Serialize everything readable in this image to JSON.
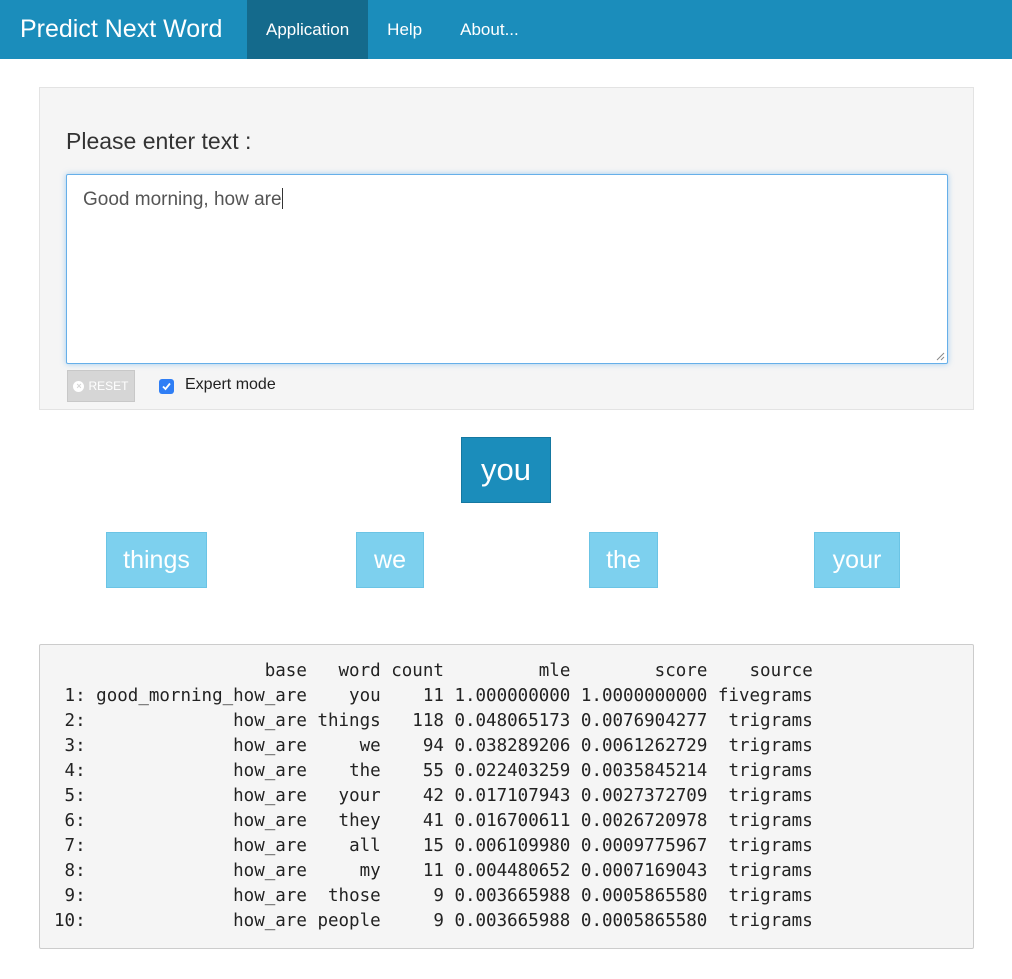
{
  "navbar": {
    "brand": "Predict Next Word",
    "tabs": [
      {
        "label": "Application",
        "active": true
      },
      {
        "label": "Help",
        "active": false
      },
      {
        "label": "About...",
        "active": false
      }
    ]
  },
  "input_panel": {
    "label": "Please enter text :",
    "text_value": "Good morning, how are",
    "reset_label": "RESET",
    "expert_mode_label": "Expert mode",
    "expert_mode_checked": true
  },
  "predictions": {
    "top": "you",
    "alternatives": [
      "things",
      "we",
      "the",
      "your"
    ]
  },
  "results_table": {
    "columns": [
      "base",
      "word",
      "count",
      "mle",
      "score",
      "source"
    ],
    "rows": [
      {
        "index": "1:",
        "base": "good_morning_how_are",
        "word": "you",
        "count": "11",
        "mle": "1.000000000",
        "score": "1.0000000000",
        "source": "fivegrams"
      },
      {
        "index": "2:",
        "base": "how_are",
        "word": "things",
        "count": "118",
        "mle": "0.048065173",
        "score": "0.0076904277",
        "source": "trigrams"
      },
      {
        "index": "3:",
        "base": "how_are",
        "word": "we",
        "count": "94",
        "mle": "0.038289206",
        "score": "0.0061262729",
        "source": "trigrams"
      },
      {
        "index": "4:",
        "base": "how_are",
        "word": "the",
        "count": "55",
        "mle": "0.022403259",
        "score": "0.0035845214",
        "source": "trigrams"
      },
      {
        "index": "5:",
        "base": "how_are",
        "word": "your",
        "count": "42",
        "mle": "0.017107943",
        "score": "0.0027372709",
        "source": "trigrams"
      },
      {
        "index": "6:",
        "base": "how_are",
        "word": "they",
        "count": "41",
        "mle": "0.016700611",
        "score": "0.0026720978",
        "source": "trigrams"
      },
      {
        "index": "7:",
        "base": "how_are",
        "word": "all",
        "count": "15",
        "mle": "0.006109980",
        "score": "0.0009775967",
        "source": "trigrams"
      },
      {
        "index": "8:",
        "base": "how_are",
        "word": "my",
        "count": "11",
        "mle": "0.004480652",
        "score": "0.0007169043",
        "source": "trigrams"
      },
      {
        "index": "9:",
        "base": "how_are",
        "word": "those",
        "count": "9",
        "mle": "0.003665988",
        "score": "0.0005865580",
        "source": "trigrams"
      },
      {
        "index": "10:",
        "base": "how_are",
        "word": "people",
        "count": "9",
        "mle": "0.003665988",
        "score": "0.0005865580",
        "source": "trigrams"
      }
    ]
  },
  "colors": {
    "navbar": "#1b8dbb",
    "navbar_active": "#146a8c",
    "prediction_main": "#1b8dbb",
    "prediction_alt": "#7dd0ee",
    "checkbox": "#2f7ef5"
  }
}
